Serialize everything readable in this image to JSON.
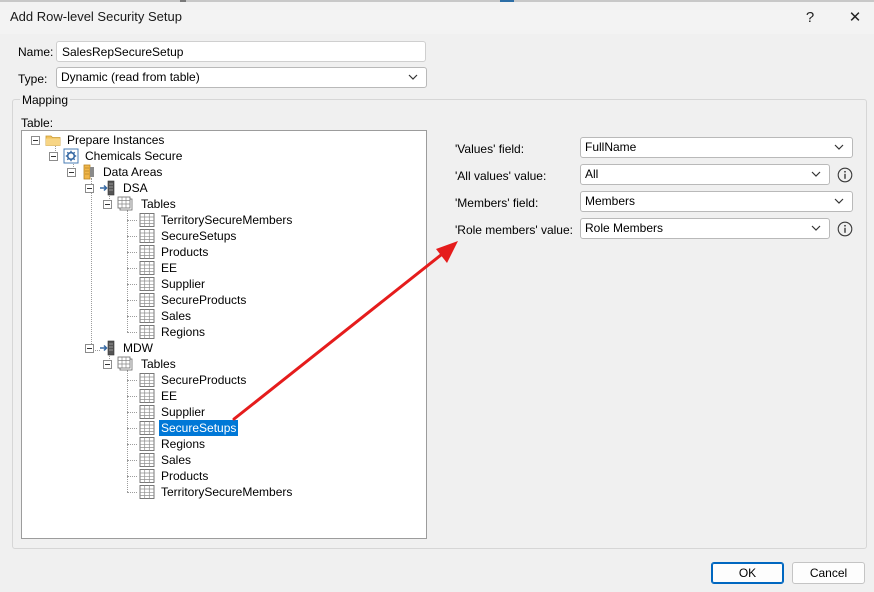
{
  "window": {
    "title": "Add Row-level Security Setup",
    "help_glyph": "?",
    "close_glyph": "✕"
  },
  "form": {
    "name_label": "Name:",
    "name_value": "SalesRepSecureSetup",
    "type_label": "Type:",
    "type_value": "Dynamic (read from table)"
  },
  "mapping": {
    "group_title": "Mapping",
    "table_label": "Table:",
    "tree": {
      "root": "Prepare Instances",
      "project": "Chemicals Secure",
      "data_areas": "Data Areas",
      "dsa": {
        "label": "DSA",
        "tables_label": "Tables",
        "tables": [
          "TerritorySecureMembers",
          "SecureSetups",
          "Products",
          "EE",
          "Supplier",
          "SecureProducts",
          "Sales",
          "Regions"
        ]
      },
      "mdw": {
        "label": "MDW",
        "tables_label": "Tables",
        "tables": [
          "SecureProducts",
          "EE",
          "Supplier",
          "SecureSetups",
          "Regions",
          "Sales",
          "Products",
          "TerritorySecureMembers"
        ]
      },
      "selected": "SecureSetups"
    },
    "fields": {
      "values_field_label": "'Values' field:",
      "values_field_value": "FullName",
      "all_values_label": "'All values' value:",
      "all_values_value": "All",
      "members_field_label": "'Members' field:",
      "members_field_value": "Members",
      "role_members_label": "'Role members' value:",
      "role_members_value": "Role Members"
    }
  },
  "buttons": {
    "ok": "OK",
    "cancel": "Cancel"
  },
  "colors": {
    "selection": "#0078d7",
    "annotation_arrow": "#e51c1c",
    "info_icon": "#3a3a3a"
  }
}
